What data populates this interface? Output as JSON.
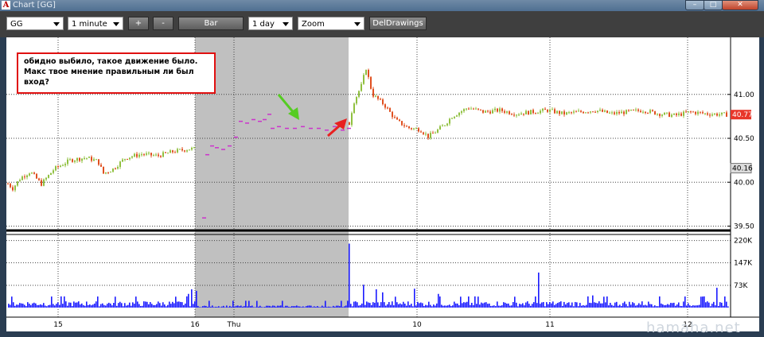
{
  "window": {
    "title": "Chart [GG]",
    "app_icon": "A"
  },
  "toolbar": {
    "symbol": "GG",
    "interval": "1 minute",
    "plus_label": "+",
    "minus_label": "-",
    "bar_label": "Bar",
    "period": "1 day",
    "zoom": "Zoom",
    "deldrawings_label": "DelDrawings"
  },
  "annotation": {
    "lines": [
      "обидно выбило, такое движение было.",
      "Макс твое мнение правильным ли был",
      "вход?"
    ]
  },
  "watermark": "hamaha.net",
  "colors": {
    "up": "#90c040",
    "down": "#e05020",
    "premarket": "#cc33cc",
    "volume": "#1a1aff",
    "shade": "#c0c0c0",
    "last_price_bg": "#e8362a"
  },
  "chart_data": {
    "type": "candlestick",
    "price_axis": {
      "ticks": [
        "41.00",
        "40.50",
        "40.00",
        "39.50"
      ],
      "ylim": [
        39.45,
        41.65
      ],
      "last_price": "40.77",
      "marker_price": "40.16"
    },
    "volume_axis": {
      "ticks": [
        "220K",
        "147K",
        "73K"
      ],
      "ylim": [
        0,
        240000
      ]
    },
    "x_ticks": [
      {
        "label": "15",
        "t": 65
      },
      {
        "label": "16",
        "t": 237
      },
      {
        "label": "Thu",
        "t": 286
      },
      {
        "label": "10",
        "t": 516
      },
      {
        "label": "11",
        "t": 683
      },
      {
        "label": "12",
        "t": 856
      }
    ],
    "shaded_regions": [
      [
        237,
        285
      ],
      [
        285,
        430
      ]
    ],
    "price_path": [
      [
        0,
        40.0
      ],
      [
        8,
        39.93
      ],
      [
        18,
        40.05
      ],
      [
        30,
        40.12
      ],
      [
        44,
        39.98
      ],
      [
        60,
        40.15
      ],
      [
        80,
        40.25
      ],
      [
        100,
        40.28
      ],
      [
        115,
        40.24
      ],
      [
        122,
        40.1
      ],
      [
        134,
        40.15
      ],
      [
        150,
        40.28
      ],
      [
        170,
        40.32
      ],
      [
        190,
        40.3
      ],
      [
        210,
        40.35
      ],
      [
        230,
        40.38
      ],
      [
        237,
        40.38
      ],
      [
        430,
        40.62
      ],
      [
        436,
        40.9
      ],
      [
        446,
        41.1
      ],
      [
        452,
        41.3
      ],
      [
        460,
        41.0
      ],
      [
        475,
        40.88
      ],
      [
        490,
        40.7
      ],
      [
        505,
        40.62
      ],
      [
        520,
        40.6
      ],
      [
        530,
        40.52
      ],
      [
        540,
        40.58
      ],
      [
        550,
        40.65
      ],
      [
        560,
        40.75
      ],
      [
        580,
        40.85
      ],
      [
        600,
        40.8
      ],
      [
        620,
        40.82
      ],
      [
        640,
        40.78
      ],
      [
        660,
        40.8
      ],
      [
        680,
        40.82
      ],
      [
        700,
        40.78
      ],
      [
        720,
        40.8
      ],
      [
        740,
        40.82
      ],
      [
        760,
        40.78
      ],
      [
        780,
        40.8
      ],
      [
        800,
        40.82
      ],
      [
        820,
        40.78
      ],
      [
        840,
        40.76
      ],
      [
        860,
        40.8
      ],
      [
        880,
        40.78
      ],
      [
        905,
        40.77
      ]
    ],
    "premarket_prints": [
      [
        246,
        39.6
      ],
      [
        250,
        40.32
      ],
      [
        256,
        40.42
      ],
      [
        262,
        40.4
      ],
      [
        270,
        40.38
      ],
      [
        278,
        40.42
      ],
      [
        286,
        40.52
      ],
      [
        292,
        40.7
      ],
      [
        300,
        40.68
      ],
      [
        308,
        40.72
      ],
      [
        316,
        40.7
      ],
      [
        322,
        40.72
      ],
      [
        328,
        40.78
      ],
      [
        332,
        40.62
      ],
      [
        340,
        40.64
      ],
      [
        350,
        40.62
      ],
      [
        360,
        40.62
      ],
      [
        370,
        40.64
      ],
      [
        380,
        40.62
      ],
      [
        390,
        40.62
      ],
      [
        400,
        40.6
      ],
      [
        410,
        40.64
      ],
      [
        420,
        40.6
      ],
      [
        428,
        40.62
      ]
    ],
    "volume_spikes": [
      [
        228,
        45000
      ],
      [
        233,
        60000
      ],
      [
        238,
        55000
      ],
      [
        431,
        210000
      ],
      [
        448,
        75000
      ],
      [
        465,
        60000
      ],
      [
        472,
        50000
      ],
      [
        512,
        62000
      ],
      [
        542,
        45000
      ],
      [
        668,
        115000
      ],
      [
        737,
        40000
      ],
      [
        893,
        65000
      ]
    ]
  }
}
